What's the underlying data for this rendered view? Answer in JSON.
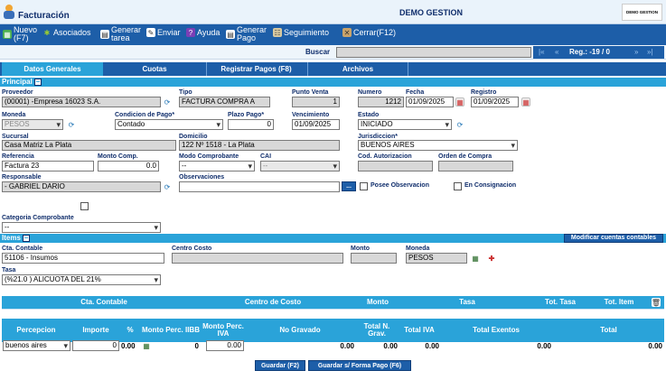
{
  "app": {
    "title": "Facturación",
    "center_title": "DEMO GESTION",
    "logo_text": "DEMO GESTION"
  },
  "toolbar": {
    "nuevo": "Nuevo",
    "nuevo_key": "(F7)",
    "asociados": "Asociados",
    "generar_tarea_1": "Generar",
    "generar_tarea_2": "tarea",
    "enviar": "Enviar",
    "ayuda": "Ayuda",
    "generar_pago_1": "Generar",
    "generar_pago_2": "Pago",
    "seguimiento": "Seguimiento",
    "cerrar": "Cerrar(F12)"
  },
  "search": {
    "label": "Buscar",
    "value": "",
    "first": "|«",
    "prev": "«",
    "reg": "Reg.: -19 / 0",
    "next": "»",
    "last": "»|"
  },
  "tabs": [
    "Datos Generales",
    "Cuotas",
    "Registrar Pagos (F8)",
    "Archivos"
  ],
  "principal": {
    "title": "Principal",
    "proveedor_label": "Proveedor",
    "proveedor": "(00001) -Empresa 16023 S.A.",
    "tipo_label": "Tipo",
    "tipo": "FACTURA COMPRA  A",
    "punto_venta_label": "Punto Venta",
    "punto_venta": "1",
    "numero_label": "Numero",
    "numero": "1212",
    "fecha_label": "Fecha",
    "fecha": "01/09/2025",
    "registro_label": "Registro",
    "registro": "01/09/2025",
    "moneda_label": "Moneda",
    "moneda": "PESOS",
    "condicion_label": "Condicion de Pago*",
    "condicion": "Contado",
    "plazo_label": "Plazo Pago*",
    "plazo": "0",
    "vencimiento_label": "Vencimiento",
    "vencimiento": "01/09/2025",
    "estado_label": "Estado",
    "estado": "INICIADO",
    "sucursal_label": "Sucursal",
    "sucursal": "Casa Matriz La Plata",
    "domicilio_label": "Domicilio",
    "domicilio": "122 Nº 1518 - La Plata",
    "jurisdiccion_label": "Jurisdiccion*",
    "jurisdiccion": "BUENOS AIRES",
    "referencia_label": "Referencia",
    "referencia": "Factura 23",
    "monto_comp_label": "Monto Comp.",
    "monto_comp": "0.0",
    "modo_label": "Modo Comprobante",
    "modo": "--",
    "cai_label": "CAI",
    "cai": "--",
    "cod_aut_label": "Cod. Autorizacion",
    "cod_aut": "",
    "orden_label": "Orden de Compra",
    "orden": "",
    "responsable_label": "Responsable",
    "responsable": "- GABRIEL DARIO",
    "observaciones_label": "Observaciones",
    "observaciones": "",
    "obs_btn": "...",
    "posee_obs": "Posee Observacion",
    "consignacion": "En Consignacion",
    "categoria_label": "Categoria Comprobante",
    "categoria": "--"
  },
  "items": {
    "title": "Items",
    "modificar": "Modificar cuentas contables",
    "cta_label": "Cta. Contable",
    "cta": "51106 - Insumos",
    "centro_label": "Centro Costo",
    "centro": "",
    "monto_label": "Monto",
    "monto": "",
    "moneda_label": "Moneda",
    "moneda": "PESOS",
    "tasa_label": "Tasa",
    "tasa": "(%21.0 ) ALICUOTA DEL 21%",
    "headers": [
      "Cta. Contable",
      "Centro de Costo",
      "Monto",
      "Tasa",
      "Tot. Tasa",
      "Tot. Item"
    ]
  },
  "percepcion": {
    "headers": [
      "Percepcion",
      "Importe",
      "%",
      "Monto Perc. IIBB",
      "Monto Perc. IVA",
      "No Gravado",
      "Total N. Grav.",
      "Total IVA",
      "Total Exentos",
      "Total"
    ],
    "percepcion": "buenos aires",
    "importe": "0",
    "pct": "0.00",
    "monto_iibb": "0",
    "monto_iva": "0.00",
    "no_gravado": "0.00",
    "total_n_grav": "0.00",
    "total_iva": "0.00",
    "total_exentos": "0.00",
    "total": "0.00"
  },
  "buttons": {
    "guardar": "Guardar (F2)",
    "guardar_forma": "Guardar s/ Forma Pago (F6)"
  },
  "colors": {
    "toolbar_bg": "#1d5ea8",
    "section_bg": "#2aa3d9",
    "label": "#0f2d6b"
  }
}
